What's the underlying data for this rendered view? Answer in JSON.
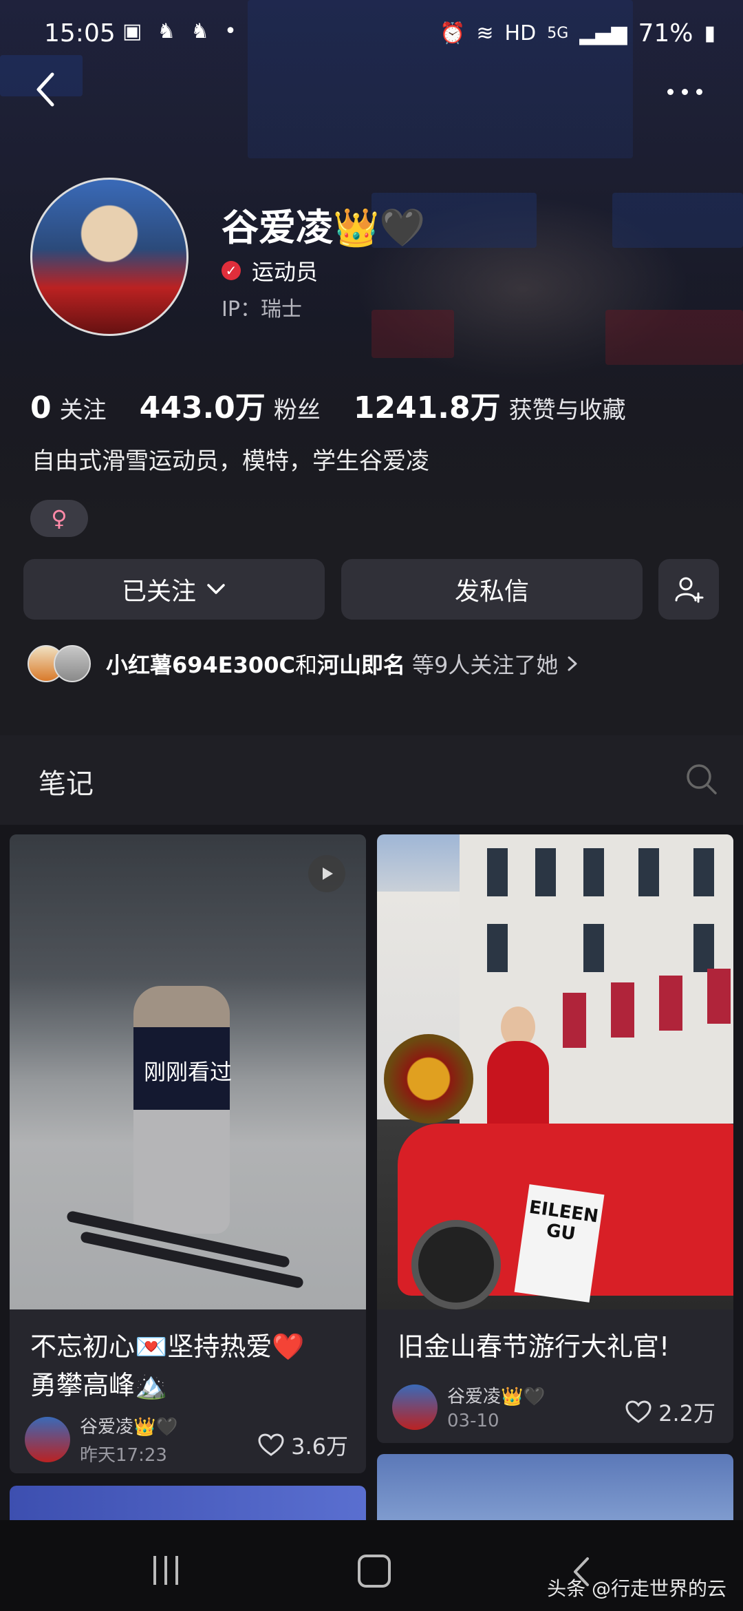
{
  "status_bar": {
    "time": "15:05",
    "network": "HD",
    "signal": "5G",
    "battery": "71%"
  },
  "profile": {
    "name": "谷爱凌",
    "name_emojis": "👑🖤",
    "verified_label": "运动员",
    "ip_label": "IP：瑞士",
    "bio": "自由式滑雪运动员，模特，学生谷爱凌",
    "gender_symbol": "♀"
  },
  "stats": [
    {
      "value": "0",
      "label": "关注"
    },
    {
      "value": "443.0万",
      "label": "粉丝"
    },
    {
      "value": "1241.8万",
      "label": "获赞与收藏"
    }
  ],
  "buttons": {
    "following": "已关注",
    "message": "发私信"
  },
  "mutual": {
    "name1": "小红薯694E300C",
    "connector": "和",
    "name2": "河山即名",
    "suffix": "等9人关注了她"
  },
  "notes": {
    "section_title": "笔记",
    "cards": [
      {
        "overlay": "刚刚看过",
        "title_line1": "不忘初心💌坚持热爱❤️",
        "title_line2": "勇攀高峰🏔️",
        "author": "谷爱凌👑🖤",
        "date": "昨天17:23",
        "likes": "3.6万"
      },
      {
        "plate_text": "EILEEN GU",
        "title_line1": "旧金山春节游行大礼官!",
        "author": "谷爱凌👑🖤",
        "date": "03-10",
        "likes": "2.2万"
      }
    ]
  },
  "watermark": "头条 @行走世界的云",
  "colors": {
    "background": "#1c1c21",
    "verify_red": "#e02e3b",
    "button_bg": "#303038"
  }
}
